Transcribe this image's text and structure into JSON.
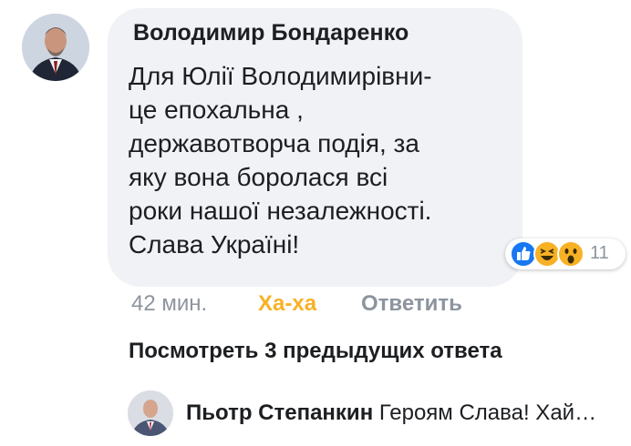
{
  "comment": {
    "author": "Володимир Бондаренко",
    "text": "Для Юлії Володимирівни-\nце епохальна ,\nдержавотворча подія, за\nяку вона боролася всі\nроки нашої незалежності.\nСлава Україні!",
    "reactions": {
      "icons": [
        "like-icon",
        "haha-icon",
        "wow-icon"
      ],
      "count": "11",
      "colors": {
        "like": "#1877f2",
        "haha": "#f7b125"
      }
    },
    "actions": {
      "time": "42 мин.",
      "reaction_label": "Ха-ха",
      "reply_label": "Ответить"
    }
  },
  "view_previous": "Посмотреть 3 предыдущих ответа",
  "reply": {
    "author": "Пьотр Степанкин",
    "text": "Героям Слава! Хай…"
  }
}
